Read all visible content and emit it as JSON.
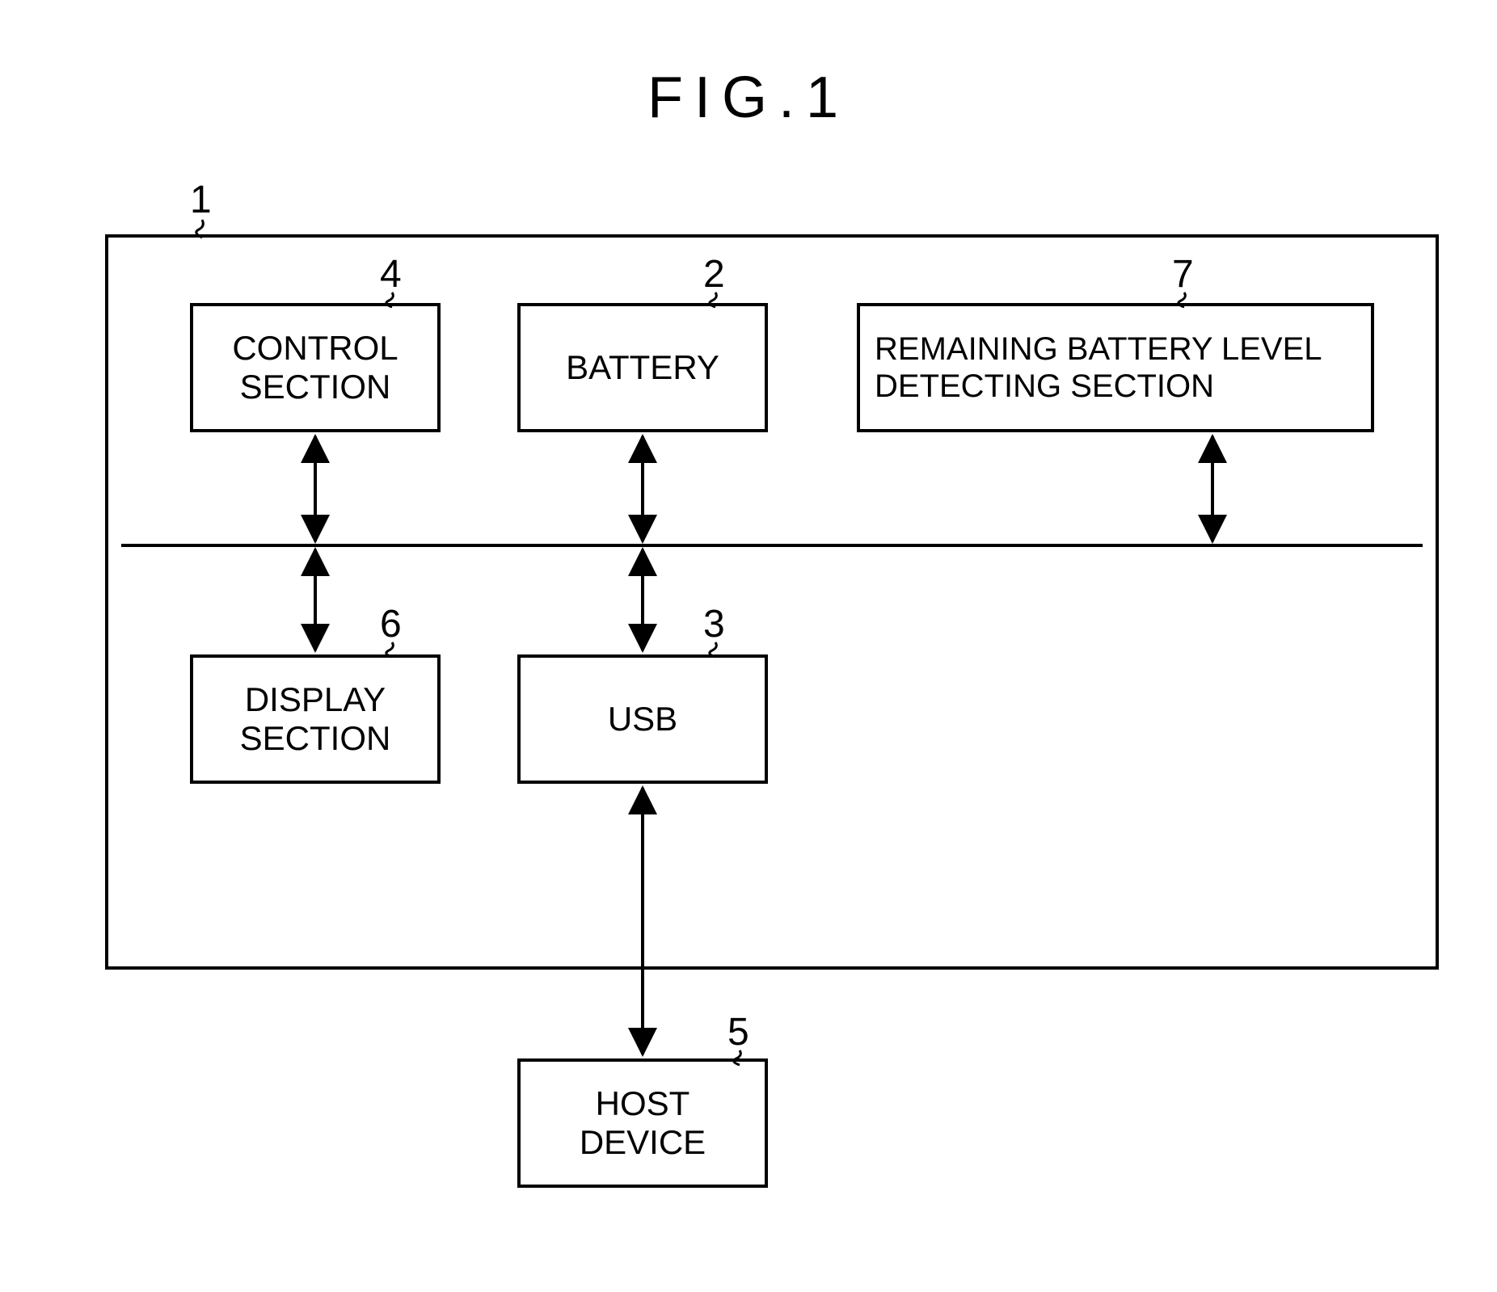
{
  "figure": {
    "title": "FIG.1",
    "outer_ref": "1",
    "blocks": {
      "control_section": {
        "ref": "4",
        "label": "CONTROL SECTION"
      },
      "battery": {
        "ref": "2",
        "label": "BATTERY"
      },
      "rem_batt": {
        "ref": "7",
        "label": "REMAINING BATTERY LEVEL DETECTING SECTION"
      },
      "display_section": {
        "ref": "6",
        "label": "DISPLAY SECTION"
      },
      "usb": {
        "ref": "3",
        "label": "USB"
      },
      "host_device": {
        "ref": "5",
        "label": "HOST DEVICE"
      }
    }
  }
}
